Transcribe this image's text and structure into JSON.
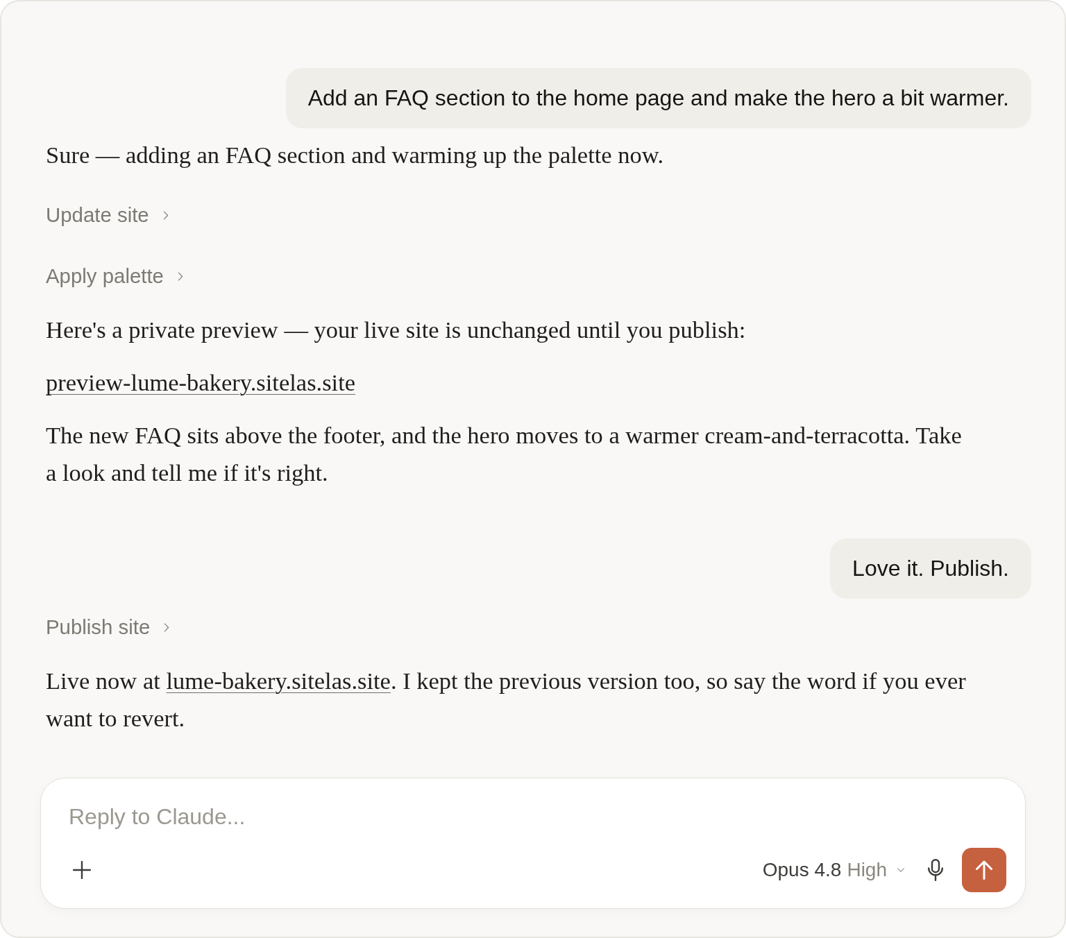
{
  "messages": [
    {
      "kind": "user",
      "text": "Add an FAQ section to the home page and make the hero a bit warmer."
    },
    {
      "kind": "text",
      "text": "Sure — adding an FAQ section and warming up the palette now."
    },
    {
      "kind": "tool",
      "label": "Update site"
    },
    {
      "kind": "tool",
      "label": "Apply palette"
    },
    {
      "kind": "text",
      "text": "Here's a private preview — your live site is unchanged until you publish:"
    },
    {
      "kind": "link",
      "text": "preview-lume-bakery.sitelas.site"
    },
    {
      "kind": "text",
      "text": "The new FAQ sits above the footer, and the hero moves to a warmer cream-and-terracotta. Take a look and tell me if it's right."
    },
    {
      "kind": "user",
      "text": "Love it. Publish."
    },
    {
      "kind": "tool",
      "label": "Publish site"
    },
    {
      "kind": "text_link",
      "before": "Live now at ",
      "link": "lume-bakery.sitelas.site",
      "after": ". I kept the previous version too, so say the word if you ever want to revert."
    }
  ],
  "composer": {
    "placeholder": "Reply to Claude...",
    "model": "Opus 4.8",
    "effort": "High"
  }
}
